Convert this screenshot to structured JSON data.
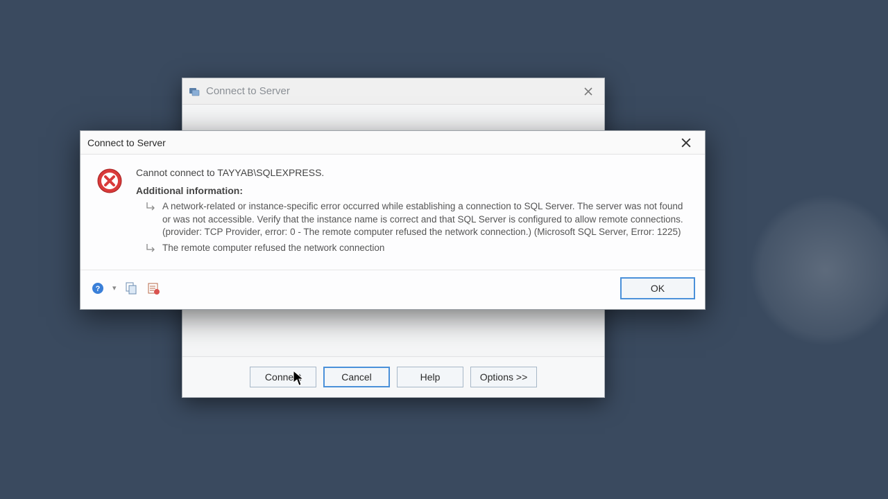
{
  "parent_dialog": {
    "title": "Connect to Server",
    "buttons": {
      "connect": "Connect",
      "cancel": "Cancel",
      "help": "Help",
      "options": "Options >>"
    }
  },
  "error_dialog": {
    "title": "Connect to Server",
    "message": "Cannot connect to TAYYAB\\SQLEXPRESS.",
    "additional_label": "Additional information:",
    "details": [
      "A network-related or instance-specific error occurred while establishing a connection to SQL Server. The server was not found or was not accessible. Verify that the instance name is correct and that SQL Server is configured to allow remote connections. (provider: TCP Provider, error: 0 - The remote computer refused the network connection.) (Microsoft SQL Server, Error: 1225)",
      "The remote computer refused the network connection"
    ],
    "ok_button": "OK"
  },
  "icons": {
    "error": "error-circle-x",
    "help": "help-circle",
    "copy": "copy-pages",
    "details": "details-page"
  }
}
